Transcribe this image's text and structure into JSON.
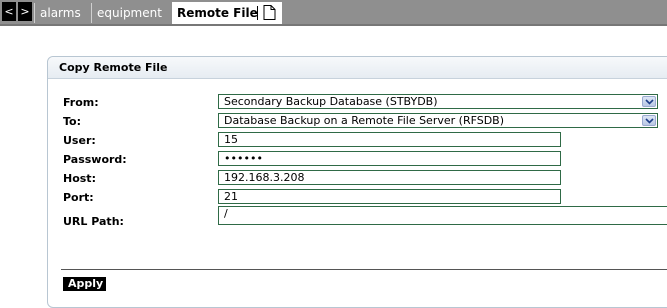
{
  "tabs": {
    "prev_glyph": "<",
    "next_glyph": ">",
    "items": [
      {
        "label": "alarms"
      },
      {
        "label": "equipment"
      },
      {
        "label": "Remote File"
      }
    ]
  },
  "panel": {
    "title": "Copy Remote File"
  },
  "form": {
    "from": {
      "label": "From:",
      "value": "Secondary Backup Database (STBYDB)"
    },
    "to": {
      "label": "To:",
      "value": "Database Backup on a Remote File Server (RFSDB)"
    },
    "user": {
      "label": "User:",
      "value": "15"
    },
    "password": {
      "label": "Password:",
      "value": "••••••"
    },
    "host": {
      "label": "Host:",
      "value": "192.168.3.208"
    },
    "port": {
      "label": "Port:",
      "value": "21"
    },
    "url_path": {
      "label": "URL Path:",
      "value": "/"
    }
  },
  "actions": {
    "apply_label": "Apply"
  },
  "colors": {
    "tabbar": "#8f8f8f",
    "field_border": "#2f6a46",
    "button": "#000000"
  }
}
